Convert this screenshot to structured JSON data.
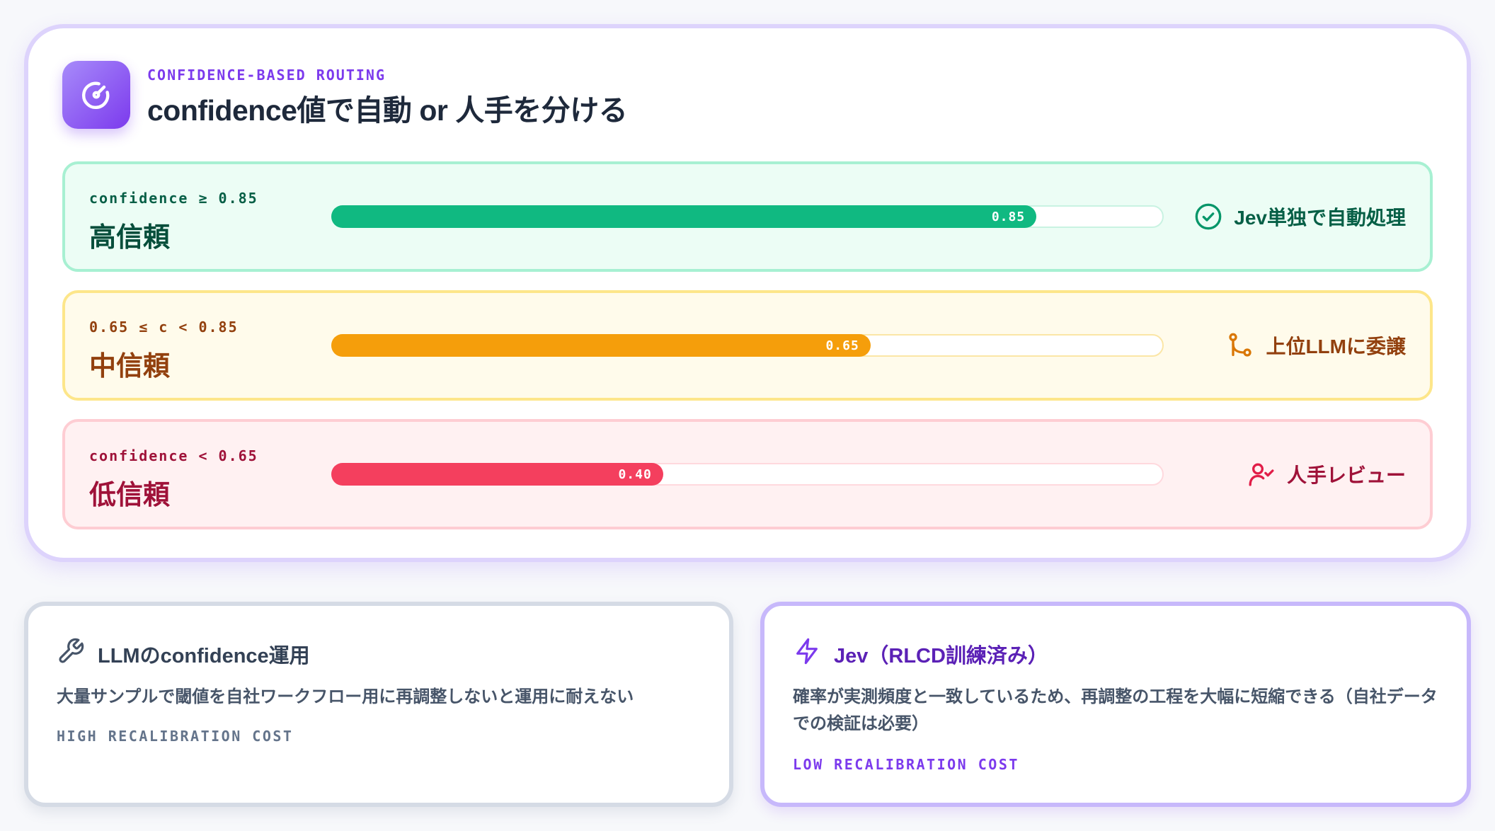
{
  "header": {
    "eyebrow": "CONFIDENCE-BASED ROUTING",
    "title": "confidence値で自動 or 人手を分ける",
    "icon": "gauge-icon"
  },
  "tiers": [
    {
      "id": "high",
      "condition": "confidence ≥ 0.85",
      "label": "高信頼",
      "value": 0.85,
      "value_label": "0.85",
      "action": "Jev単独で自動処理",
      "icon": "check-circle-icon",
      "color": "#10b981"
    },
    {
      "id": "mid",
      "condition": "0.65 ≤ c < 0.85",
      "label": "中信頼",
      "value": 0.65,
      "value_label": "0.65",
      "action": "上位LLMに委譲",
      "icon": "git-branch-icon",
      "color": "#f59e0b"
    },
    {
      "id": "low",
      "condition": "confidence < 0.65",
      "label": "低信頼",
      "value": 0.4,
      "value_label": "0.40",
      "action": "人手レビュー",
      "icon": "user-check-icon",
      "color": "#f43f5e"
    }
  ],
  "cards": {
    "left": {
      "title": "LLMのconfidence運用",
      "body": "大量サンプルで閾値を自社ワークフロー用に再調整しないと運用に耐えない",
      "tag": "HIGH RECALIBRATION COST",
      "icon": "wrench-icon"
    },
    "right": {
      "title": "Jev（RLCD訓練済み）",
      "body": "確率が実測頻度と一致しているため、再調整の工程を大幅に短縮できる（自社データでの検証は必要）",
      "tag": "LOW RECALIBRATION COST",
      "icon": "lightning-icon"
    }
  }
}
